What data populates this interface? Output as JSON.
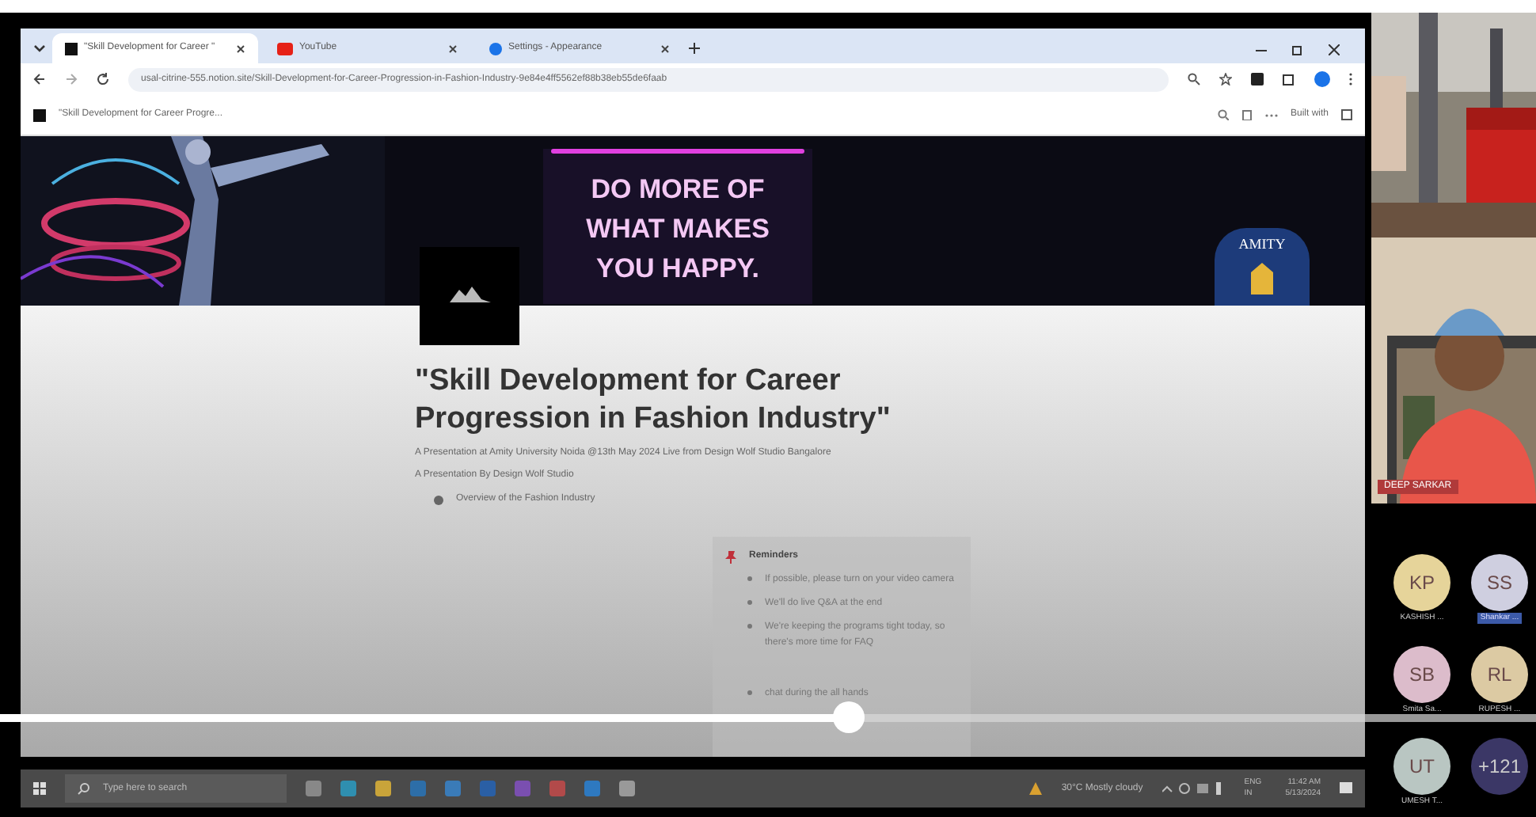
{
  "browser": {
    "tabs": [
      {
        "title": "\"Skill Development for Career \"",
        "kind": "page",
        "selected": true
      },
      {
        "title": "YouTube",
        "kind": "video",
        "selected": false
      },
      {
        "title": "Settings - Appearance",
        "kind": "settings",
        "selected": false
      }
    ],
    "url": "usal-citrine-555.notion.site/Skill-Development-for-Career-Progression-in-Fashion-Industry-9e84e4ff5562ef88b38eb55de6faab",
    "page_tab": "\"Skill Development for Career Progre...",
    "built_with": "Built with"
  },
  "banner": {
    "lines": [
      "DO MORE OF",
      "WHAT MAKES",
      "YOU HAPPY."
    ],
    "badge": "AMITY"
  },
  "page": {
    "title": "\"Skill Development for Career Progression in Fashion Industry\"",
    "subtitles": [
      "A Presentation at Amity University Noida @13th May 2024 Live from Design Wolf Studio Bangalore",
      "A Presentation By Design Wolf Studio"
    ],
    "toggle": "Overview of the Fashion Industry",
    "callout": {
      "title": "Reminders",
      "items": [
        "If possible, please turn on your video camera",
        "We'll do live Q&A at the end",
        "We're keeping the programs tight today, so there's more time for FAQ",
        "chat during the all hands"
      ]
    }
  },
  "player": {
    "level": 0.553
  },
  "taskbar": {
    "search_placeholder": "Type here to search",
    "weather": "30°C  Mostly cloudy",
    "lang": "ENG IN",
    "time": "11:42 AM",
    "date": "5/13/2024"
  },
  "meeting": {
    "speaker": "DEEP SARKAR",
    "participants": [
      {
        "initials": "KP",
        "name": "KASHISH ...",
        "color": "#e6d49a",
        "highlighted": false
      },
      {
        "initials": "SS",
        "name": "Shankar ...",
        "color": "#cfcfe0",
        "highlighted": true
      },
      {
        "initials": "SB",
        "name": "Smita Sa...",
        "color": "#dcbccb",
        "highlighted": false
      },
      {
        "initials": "RL",
        "name": "RUPESH ...",
        "color": "#dccaa3",
        "highlighted": false
      },
      {
        "initials": "UT",
        "name": "UMESH T...",
        "color": "#b9c6c2",
        "highlighted": false
      },
      {
        "initials": "+121",
        "color": "#3b3766"
      }
    ]
  }
}
